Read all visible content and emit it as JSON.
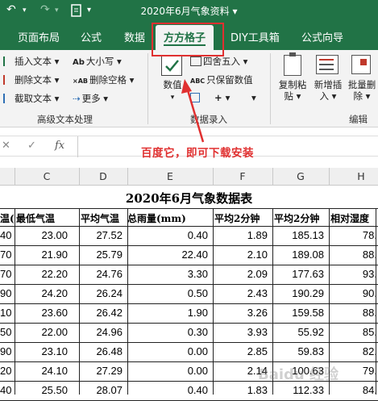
{
  "window": {
    "title": "2020年6月气象资料 ▾"
  },
  "quick_access": {
    "undo": "↶",
    "redo": "↷"
  },
  "tabs": [
    "页面布局",
    "公式",
    "数据",
    "方方格子",
    "DIY工具箱",
    "公式向导"
  ],
  "ribbon": {
    "text_group": {
      "items": [
        "插入文本 ▾",
        "删除文本 ▾",
        "截取文本 ▾"
      ],
      "items2": [
        "大小写 ▾",
        "删除空格 ▾",
        "更多 ▾"
      ],
      "label": "高级文本处理"
    },
    "number_group": {
      "big_button": "数值",
      "items": [
        "四舍五入 ▾",
        "只保留数值",
        "+ ▾"
      ],
      "label": "数据录入"
    },
    "edit_group": {
      "buttons": [
        "复制粘贴 ▾",
        "新增插入 ▾",
        "批量删除 ▾"
      ],
      "label": "编辑"
    }
  },
  "formula_bar": {
    "cancel": "✕",
    "confirm": "✓",
    "fx": "fx"
  },
  "annotation": {
    "text": "百度它，即可下载安装"
  },
  "columns": [
    "C",
    "D",
    "E",
    "F",
    "G",
    "H"
  ],
  "sheet": {
    "title": "2020年6月气象数据表",
    "headers": [
      "温(",
      "最低气温",
      "平均气温",
      "总雨量(mm)",
      "平均2分钟",
      "平均2分钟",
      "相对湿度"
    ],
    "rows": [
      [
        "40",
        "23.00",
        "27.52",
        "0.40",
        "1.89",
        "185.13",
        "78."
      ],
      [
        "70",
        "21.90",
        "25.79",
        "22.40",
        "2.10",
        "189.08",
        "88."
      ],
      [
        "70",
        "22.20",
        "24.76",
        "3.30",
        "2.09",
        "177.63",
        "93."
      ],
      [
        "90",
        "24.20",
        "26.24",
        "0.50",
        "2.43",
        "190.29",
        "90."
      ],
      [
        "10",
        "23.60",
        "26.42",
        "1.90",
        "3.26",
        "159.58",
        "88."
      ],
      [
        "50",
        "22.00",
        "24.96",
        "0.30",
        "3.93",
        "55.92",
        "85."
      ],
      [
        "90",
        "23.10",
        "26.48",
        "0.00",
        "2.85",
        "59.83",
        "82."
      ],
      [
        "20",
        "24.10",
        "27.29",
        "0.00",
        "2.14",
        "100.63",
        "79."
      ],
      [
        "40",
        "25.50",
        "28.07",
        "0.40",
        "1.83",
        "112.33",
        "84."
      ]
    ]
  },
  "colors": {
    "excel_green": "#217346",
    "highlight_red": "#e03030"
  }
}
